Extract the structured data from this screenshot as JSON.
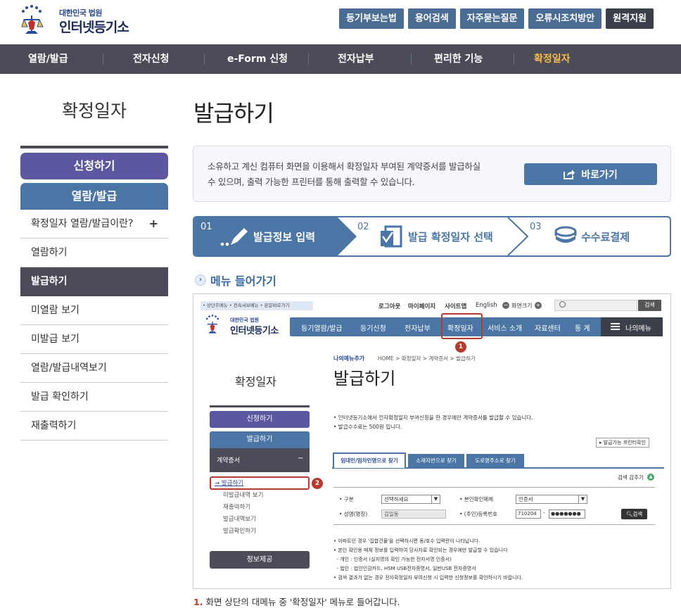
{
  "logo": {
    "subtitle": "대한민국 법원",
    "title": "인터넷등기소",
    "emblem_icon": "court-emblem-icon"
  },
  "top_buttons": [
    "등기부보는법",
    "용어검색",
    "자주묻는질문",
    "오류시조치방안",
    "원격지원"
  ],
  "gnb": [
    {
      "label": "열람/발급",
      "active": false
    },
    {
      "label": "전자신청",
      "active": false
    },
    {
      "label": "e-Form 신청",
      "active": false
    },
    {
      "label": "전자납부",
      "active": false
    },
    {
      "label": "편리한 기능",
      "active": false
    },
    {
      "label": "확정일자",
      "active": true
    }
  ],
  "sidebar": {
    "title": "확정일자",
    "apply_button": "신청하기",
    "view_button": "열람/발급",
    "items": [
      {
        "label": "확정일자 열람/발급이란?",
        "plus": "+",
        "active": false
      },
      {
        "label": "열람하기",
        "active": false
      },
      {
        "label": "발급하기",
        "active": true
      },
      {
        "label": "미열람 보기",
        "active": false
      },
      {
        "label": "미발급 보기",
        "active": false
      },
      {
        "label": "열람/발급내역보기",
        "active": false
      },
      {
        "label": "발급 확인하기",
        "active": false
      },
      {
        "label": "재출력하기",
        "active": false
      }
    ]
  },
  "main": {
    "title": "발급하기",
    "info_line1": "소유하고 계신 컴퓨터 화면을 이용해서 확정일자 부여된 계약증서를 발급하실",
    "info_line2": "수 있으며, 출력 가능한 프린터를 통해 출력할 수 있습니다.",
    "go_button": "바로가기",
    "steps": [
      {
        "num": "01",
        "label": "발급정보 입력",
        "icon": "pencil-icon"
      },
      {
        "num": "02",
        "label": "발급 확정일자 선택",
        "icon": "document-check-icon"
      },
      {
        "num": "03",
        "label": "수수료결제",
        "icon": "coins-icon"
      }
    ],
    "menu_enter": "메뉴 들어가기",
    "caption_num": "1.",
    "caption_text": "화면 상단의 대메뉴 중 '확정일자' 메뉴로 들어갑니다."
  },
  "screenshot": {
    "skip_links": "• 상단주메뉴  • 전속서브메뉴  • 본문바로가기",
    "util_links": [
      "로그아웃",
      "마이페이지",
      "사이트맵",
      "English"
    ],
    "zoom_label": "화면크기",
    "search_button": "검색",
    "logo_sub": "대한민국 법원",
    "logo_title": "인터넷등기소",
    "gnb": [
      "등기열람/발급",
      "등기신청",
      "전자납부",
      "확정일자",
      "서비스 소개",
      "자료센터",
      "통 계"
    ],
    "my_menu": "나의메뉴",
    "my_menu_add": "나의메뉴추가",
    "breadcrumb": "HOME > 확정일자 > 계약증서 > 발급하기",
    "page_title": "발급하기",
    "side_title": "확정일자",
    "side_apply": "신청하기",
    "side_issue": "발급하기",
    "side_contract": "계약증서",
    "side_minus": "−",
    "side_items": [
      "→ 발급하기",
      "미발급내역 보기",
      "재출력하기",
      "발급내역보기",
      "발급확인하기"
    ],
    "side_info": "정보제공",
    "notice1": "• 인터넷등기소에서 전자확정일자 부여신청을 한 경우에만 계약증서를 발급할 수 있습니다.",
    "notice2": "• 발급수수료는 500원 입니다.",
    "printer_button": "▸ 발급가능 프린터확인",
    "tabs": [
      "임대인/임차인명으로 찾기",
      "소재지번으로 찾기",
      "도로명주소로 찾기"
    ],
    "fold_label": "검색 감추기",
    "form": {
      "type_label": "• 구분",
      "type_value": "선택하세요",
      "id_method_label": "• 본인확인매체",
      "id_method_value": "인증서",
      "name_label": "• 성명(명칭)",
      "name_value": "김일동",
      "reg_label": "• (주민)등록번호",
      "reg_front": "710204",
      "reg_dash": "-",
      "reg_back": "●●●●●●●",
      "search_button": "검색"
    },
    "notes": [
      "• 아파트인 경우 '집합건물'을 선택하시면 동/호수 입력란이 나타납니다.",
      "• 본인 확인용 매체 정보를 입력하여 당사자로 확인되는 경우에만 발급할 수 있습니다",
      "  - 개인 : 인증서 (실지명의 확인 가능한 전자서명 인증서)",
      "  - 법인 : 법인인감카드, HSM USB전자증명서, 일반USB 전자증명서",
      "• 검색 결과가 없는 경우 전자확정일자 부여신청 시 입력한 신청정보를 확인하시기 바랍니다."
    ],
    "markers": [
      "1",
      "2"
    ]
  },
  "colors": {
    "nav": "#4b4c57",
    "accent_blue": "#4a75a4",
    "purple": "#5c58a0",
    "active_gnb": "#f6b94a",
    "marker_red": "#b5392d"
  }
}
